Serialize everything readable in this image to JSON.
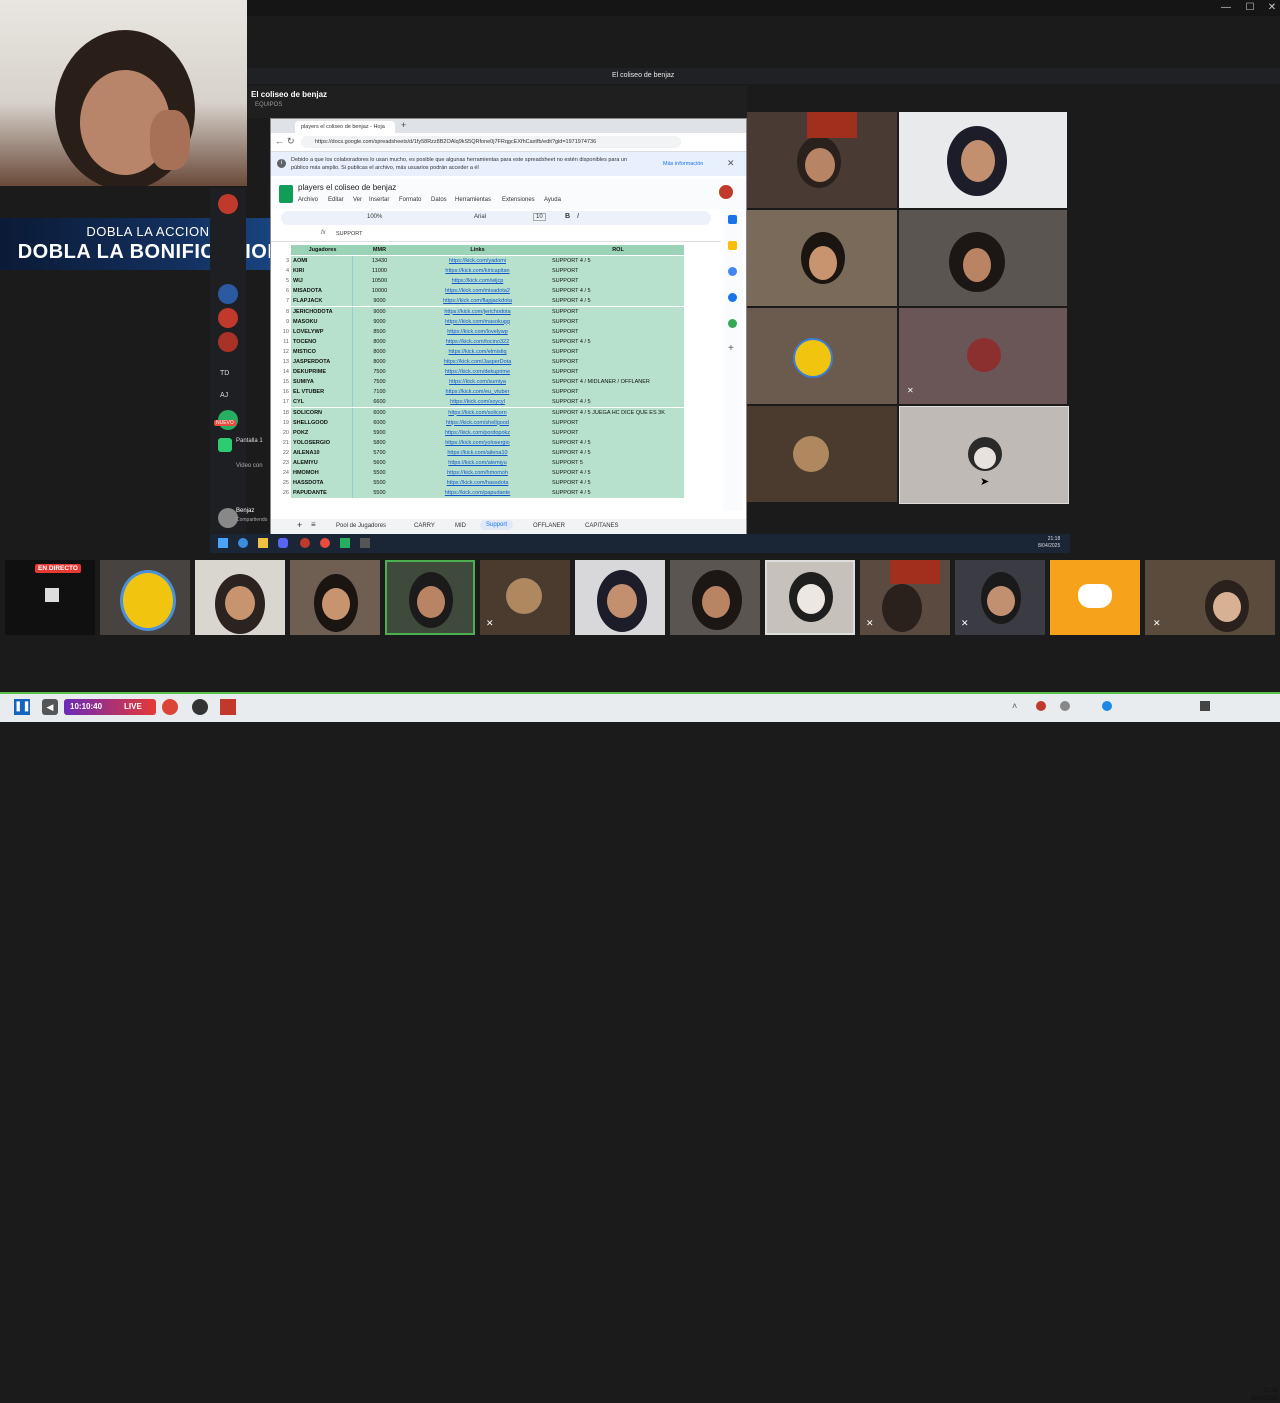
{
  "meet": {
    "window_title": "El coliseo de benjaz",
    "header_title": "El coliseo de benjaz",
    "header_sub": "EQUIPOS"
  },
  "banner": {
    "line1": "DOBLA LA ACCION,",
    "line2": "DOBLA LA BONIFICACION"
  },
  "browser": {
    "tab_title": "players el coliseo de benjaz - Hoja",
    "url": "https://docs.google.com/spreadsheets/d/1fy58Rzz8B2OAlq9kS5QRfone0j7FRqgcEXfhCaxtfb/edit?gid=1971974736",
    "notice": "Debido a que los colaboradores lo usan mucho, es posible que algunas herramientas para este spreadsheet no estén disponibles para un público más amplio. Si publicas el archivo, más usuarios podrán acceder a él",
    "notice_link": "Más información",
    "doc_title": "players el coliseo de benjaz",
    "menus": [
      "Archivo",
      "Editar",
      "Ver",
      "Insertar",
      "Formato",
      "Datos",
      "Herramientas",
      "Extensiones",
      "Ayuda"
    ],
    "zoom": "100%",
    "font": "Arial",
    "font_size": "10",
    "formula_value": "SUPPORT",
    "sheet_tabs": [
      "Pool de Jugadores",
      "CARRY",
      "MID",
      "Support",
      "OFFLANER",
      "CAPITANES"
    ],
    "active_tab": "Support"
  },
  "sheet": {
    "headers": [
      "Jugadores",
      "MMR",
      "Links",
      "ROL"
    ],
    "rows": [
      [
        "AOMI",
        "13430",
        "https://kick.com/yadomi",
        "SUPPORT 4 / 5"
      ],
      [
        "KIRI",
        "11000",
        "https://kick.com/kiricapitan",
        "SUPPORT"
      ],
      [
        "WIJ",
        "10500",
        "https://kick.com/wijcp",
        "SUPPORT"
      ],
      [
        "MISADOTA",
        "10000",
        "https://kick.com/misadota2",
        "SUPPORT 4 / 5"
      ],
      [
        "FLAPJACK",
        "9000",
        "https://kick.com/flapjackdota",
        "SUPPORT 4 / 5"
      ],
      [
        "JERICHODOTA",
        "9000",
        "https://kick.com/jerichodota",
        "SUPPORT"
      ],
      [
        "MASOKU",
        "9000",
        "https://kick.com/masokugg",
        "SUPPORT"
      ],
      [
        "LOVELYWP",
        "8500",
        "https://kick.com/lovelywp",
        "SUPPORT"
      ],
      [
        "TOCENO",
        "8000",
        "https://kick.com/tocino322",
        "SUPPORT 4 / 5"
      ],
      [
        "MISTICO",
        "8000",
        "https://kick.com/elmistiq",
        "SUPPORT"
      ],
      [
        "JASPERDOTA",
        "8000",
        "https://kick.com/JasperDota",
        "SUPPORT"
      ],
      [
        "DEKUPRIME",
        "7500",
        "https://kick.com/dekuprime",
        "SUPPORT"
      ],
      [
        "SUMIYA",
        "7500",
        "https://kick.com/sumiya",
        "SUPPORT 4 / MIDLANER / OFFLANER"
      ],
      [
        "EL VTUBER",
        "7100",
        "https://kick.com/eu_vtuber",
        "SUPPORT"
      ],
      [
        "CYL",
        "6600",
        "https://kick.com/soycyl",
        "SUPPORT 4 / 5"
      ],
      [
        "SOLICORN",
        "6000",
        "https://kick.com/solicorn",
        "SUPPORT 4 / 5 JUEGA HC DICE QUE ES 3K"
      ],
      [
        "SHELLGOOD",
        "6000",
        "https://kick.com/shellgood",
        "SUPPORT"
      ],
      [
        "POKZ",
        "5900",
        "https://kick.com/pordopokz",
        "SUPPORT"
      ],
      [
        "YOLOSERGIO",
        "5800",
        "https://kick.com/yolosergio",
        "SUPPORT 4 / 5"
      ],
      [
        "AILENA10",
        "5700",
        "https://kick.com/ailena10",
        "SUPPORT 4 / 5"
      ],
      [
        "ALEMIYU",
        "5600",
        "https://kick.com/alemiyu",
        "SUPPORT 5"
      ],
      [
        "HMOMOH",
        "5500",
        "https://kick.com/hmomoh",
        "SUPPORT 4 / 5"
      ],
      [
        "HASSDOTA",
        "5500",
        "https://kick.com/hassdota",
        "SUPPORT 4 / 5"
      ],
      [
        "PAPUDANTE",
        "5500",
        "https://kick.com/papudante",
        "SUPPORT 4 / 5"
      ]
    ]
  },
  "discord": {
    "left_labels": [
      "TD",
      "AJ"
    ],
    "nuevo": "NUEVO",
    "screen_label": "Pantalla 1",
    "video_label": "Video con",
    "user": "Benjaz",
    "user_sub": "Compartiendo"
  },
  "strip": {
    "live_badge": "EN DIRECTO"
  },
  "taskbar": {
    "time_rec": "10:10:40",
    "live": "LIVE",
    "clock_time": "21:18",
    "clock_date": "8/04/2025"
  },
  "taskbar2": {
    "clock_time": "21:18",
    "clock_date": "8/04/2025"
  },
  "colors": {
    "sheet_green": "#b7e1cd",
    "discord_orange": "#f7a21b",
    "taskbar_green": "#59c24a"
  }
}
